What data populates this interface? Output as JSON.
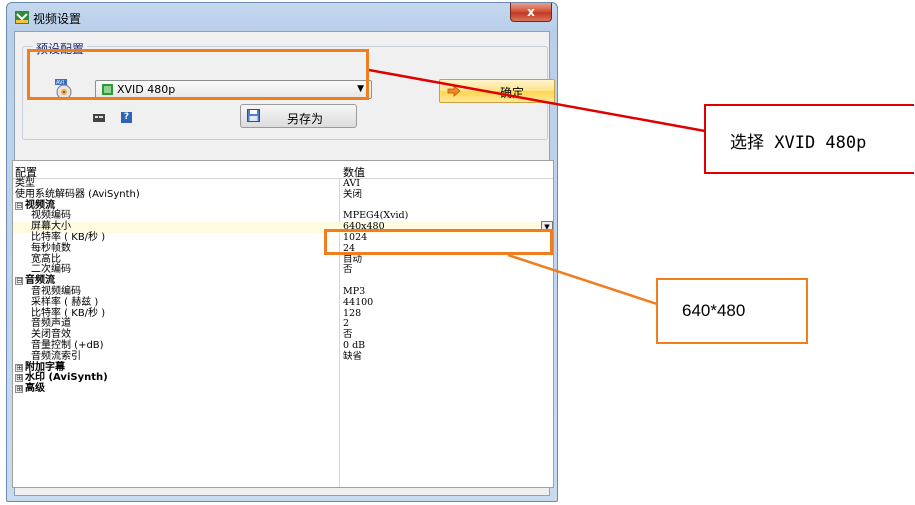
{
  "window": {
    "title": "视频设置",
    "close_label": "x"
  },
  "preset": {
    "group_label": "预设配置",
    "selected": "XVID 480p",
    "ok_label": "确定",
    "save_as_label": "另存为",
    "help_label": "?"
  },
  "grid": {
    "header_name": "配置",
    "header_value": "数值",
    "rows": [
      {
        "kind": "prop",
        "name": "类型",
        "value": "AVI"
      },
      {
        "kind": "prop",
        "name": "使用系统解码器 (AviSynth)",
        "value": "关闭"
      },
      {
        "kind": "cat",
        "name": "视频流",
        "expander": "⊟"
      },
      {
        "kind": "child",
        "name": "视频编码",
        "value": "MPEG4(Xvid)"
      },
      {
        "kind": "child",
        "name": "屏幕大小",
        "value": "640x480",
        "selected": true
      },
      {
        "kind": "child",
        "name": "比特率 ( KB/秒 )",
        "value": "1024"
      },
      {
        "kind": "child",
        "name": "每秒帧数",
        "value": "24"
      },
      {
        "kind": "child",
        "name": "宽高比",
        "value": "自动"
      },
      {
        "kind": "child",
        "name": "二次编码",
        "value": "否"
      },
      {
        "kind": "cat",
        "name": "音频流",
        "expander": "⊟"
      },
      {
        "kind": "child",
        "name": "音视频编码",
        "value": "MP3"
      },
      {
        "kind": "child",
        "name": "采样率 ( 赫兹 )",
        "value": "44100"
      },
      {
        "kind": "child",
        "name": "比特率 ( KB/秒 )",
        "value": "128"
      },
      {
        "kind": "child",
        "name": "音频声道",
        "value": "2"
      },
      {
        "kind": "child",
        "name": "关闭音效",
        "value": "否"
      },
      {
        "kind": "child",
        "name": "音量控制 (+dB)",
        "value": "0 dB"
      },
      {
        "kind": "child",
        "name": "音频流索引",
        "value": "缺省"
      },
      {
        "kind": "cat",
        "name": "附加字幕",
        "expander": "⊞"
      },
      {
        "kind": "cat",
        "name": "水印 (AviSynth)",
        "expander": "⊞"
      },
      {
        "kind": "cat",
        "name": "高级",
        "expander": "⊞"
      }
    ]
  },
  "annotations": {
    "callout_preset": "选择 XVID 480p",
    "callout_size": "640*480",
    "preset_color": "#e00000",
    "size_color": "#f07d1e"
  }
}
